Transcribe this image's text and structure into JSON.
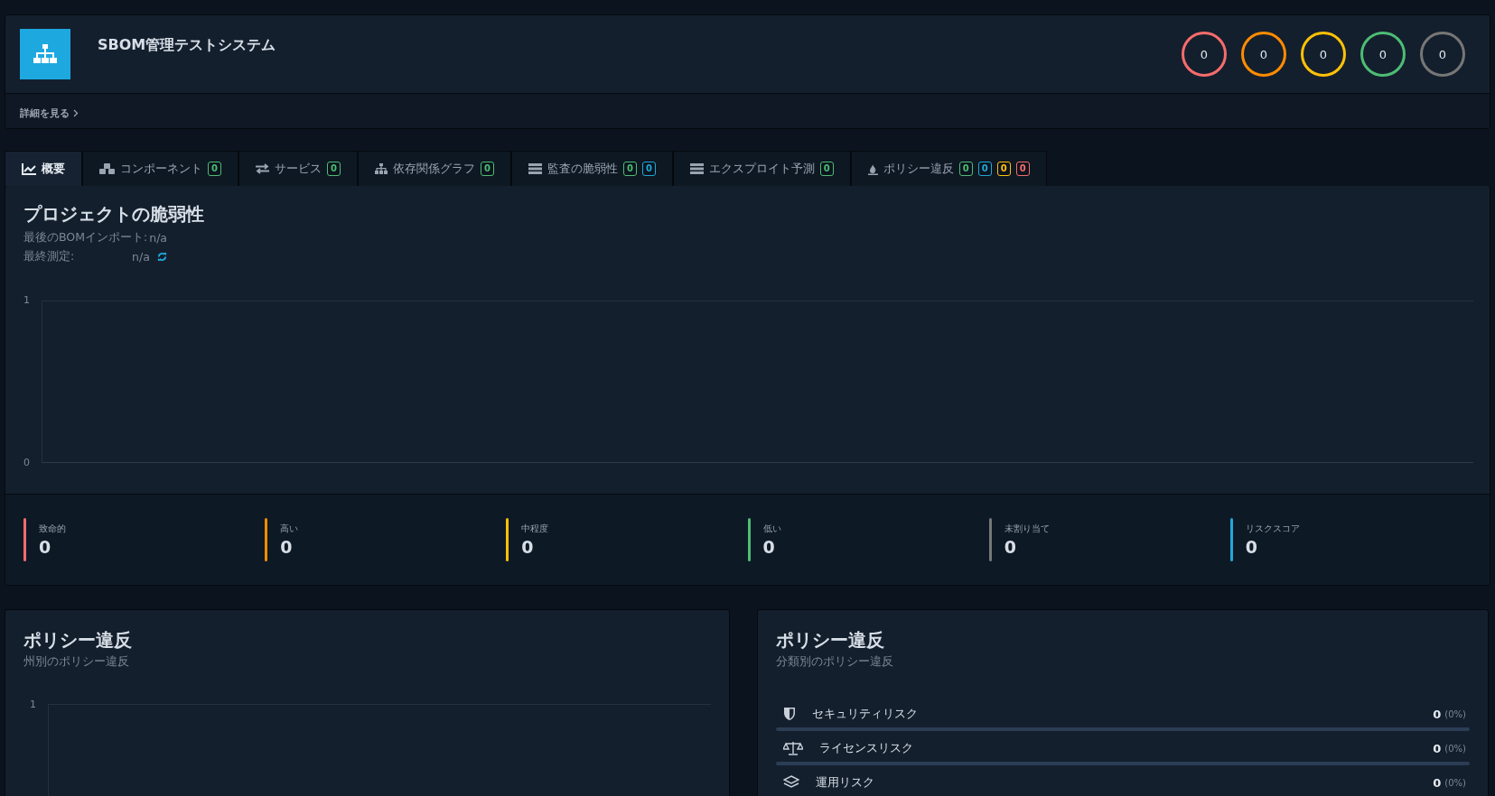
{
  "project": {
    "title": "SBOM管理テストシステム",
    "details_link": "詳細を見る"
  },
  "severity_counts": [
    {
      "value": "0",
      "color": "#f86c6b"
    },
    {
      "value": "0",
      "color": "#ff8c00"
    },
    {
      "value": "0",
      "color": "#ffc107"
    },
    {
      "value": "0",
      "color": "#4dbd74"
    },
    {
      "value": "0",
      "color": "#777777"
    }
  ],
  "tabs": [
    {
      "label": "概要",
      "kind": "chart",
      "selected": true
    },
    {
      "label": "コンポーネント",
      "kind": "cubes",
      "selected": false,
      "badges": [
        {
          "text": "0",
          "color": "#4dbd74"
        }
      ]
    },
    {
      "label": "サービス",
      "kind": "exchange",
      "selected": false,
      "badges": [
        {
          "text": "0",
          "color": "#4dbd74"
        }
      ]
    },
    {
      "label": "依存関係グラフ",
      "kind": "sitemap",
      "selected": false,
      "badges": [
        {
          "text": "0",
          "color": "#4dbd74"
        }
      ]
    },
    {
      "label": "監査の脆弱性",
      "kind": "server",
      "selected": false,
      "badges": [
        {
          "text": "0",
          "color": "#4dbd74"
        },
        {
          "text": "0",
          "color": "#20a8d8"
        }
      ]
    },
    {
      "label": "エクスプロイト予測",
      "kind": "server",
      "selected": false,
      "badges": [
        {
          "text": "0",
          "color": "#4dbd74"
        }
      ]
    },
    {
      "label": "ポリシー違反",
      "kind": "fire",
      "selected": false,
      "badges": [
        {
          "text": "0",
          "color": "#4dbd74"
        },
        {
          "text": "0",
          "color": "#20a8d8"
        },
        {
          "text": "0",
          "color": "#ffc107"
        },
        {
          "text": "0",
          "color": "#f86c6b"
        }
      ]
    }
  ],
  "vulnerabilities": {
    "title": "プロジェクトの脆弱性",
    "last_import_label": "最後のBOMインポート:",
    "last_import_value": "n/a",
    "last_measured_label": "最終測定:",
    "last_measured_value": "n/a",
    "y_tick_labels": [
      "1",
      "0"
    ],
    "stats": [
      {
        "label": "致命的",
        "value": "0",
        "color": "#f86c6b"
      },
      {
        "label": "高い",
        "value": "0",
        "color": "#ff8c00"
      },
      {
        "label": "中程度",
        "value": "0",
        "color": "#ffc107"
      },
      {
        "label": "低い",
        "value": "0",
        "color": "#4dbd74"
      },
      {
        "label": "未割り当て",
        "value": "0",
        "color": "#777777"
      },
      {
        "label": "リスクスコア",
        "value": "0",
        "color": "#20a8d8"
      }
    ]
  },
  "policy_by_state": {
    "title": "ポリシー違反",
    "subtitle": "州別のポリシー違反",
    "y_tick_labels": [
      "1"
    ]
  },
  "policy_by_class": {
    "title": "ポリシー違反",
    "subtitle": "分類別のポリシー違反",
    "items": [
      {
        "kind": "security",
        "label": "セキュリティリスク",
        "count": "0",
        "percent": "(0%)",
        "level": 0
      },
      {
        "kind": "license",
        "label": "ライセンスリスク",
        "count": "0",
        "percent": "(0%)",
        "level": 0
      },
      {
        "kind": "operational",
        "label": "運用リスク",
        "count": "0",
        "percent": "(0%)"
      }
    ]
  }
}
